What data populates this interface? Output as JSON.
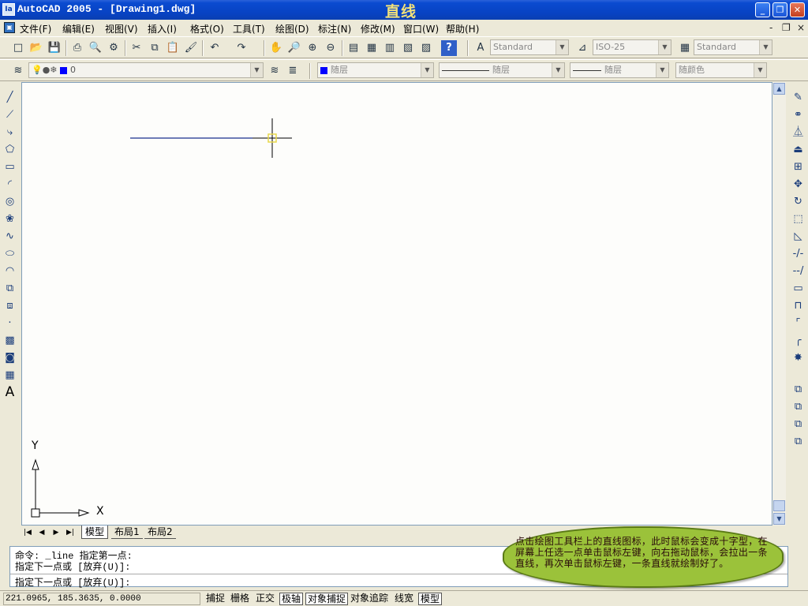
{
  "window": {
    "title": "AutoCAD 2005 - [Drawing1.dwg]",
    "overlay_title": "直线",
    "app_icon": "Ia",
    "controls": [
      "_",
      "❐",
      "✕"
    ]
  },
  "menu": {
    "items": [
      "文件(F)",
      "编辑(E)",
      "视图(V)",
      "插入(I)",
      "格式(O)",
      "工具(T)",
      "绘图(D)",
      "标注(N)",
      "修改(M)",
      "窗口(W)",
      "帮助(H)"
    ],
    "mdi_controls": [
      "-",
      "❐",
      "×"
    ]
  },
  "standard_toolbar": {
    "text_style": "Standard",
    "dim_style": "ISO-25",
    "table_style": "Standard"
  },
  "layers_toolbar": {
    "layer_name": "0",
    "color": "随层",
    "linetype": "随层",
    "lineweight": "随层",
    "plotstyle": "随颜色"
  },
  "drawing": {
    "ucs_x": "X",
    "ucs_y": "Y"
  },
  "tabs": {
    "labels": [
      "模型",
      "布局1",
      "布局2"
    ]
  },
  "command": {
    "history_1": "命令: _line 指定第一点:",
    "history_2": "指定下一点或 [放弃(U)]:",
    "prompt": "指定下一点或 [放弃(U)]:"
  },
  "tip": {
    "text": "点击绘图工具栏上的直线图标，此时鼠标会变成十字型，在屏幕上任选一点单击鼠标左键，向右拖动鼠标，会拉出一条直线，再次单击鼠标左键，一条直线就绘制好了。"
  },
  "status": {
    "coords": "221.0965, 185.3635, 0.0000",
    "toggles": [
      "捕捉",
      "栅格",
      "正交",
      "极轴",
      "对象捕捉",
      "对象追踪",
      "线宽",
      "模型"
    ]
  },
  "colors": {
    "title_bar": "#0842c2",
    "drawn_line": "#1a2f8c",
    "bubble": "#9bc23a",
    "layer_swatch": "#0000ff"
  }
}
